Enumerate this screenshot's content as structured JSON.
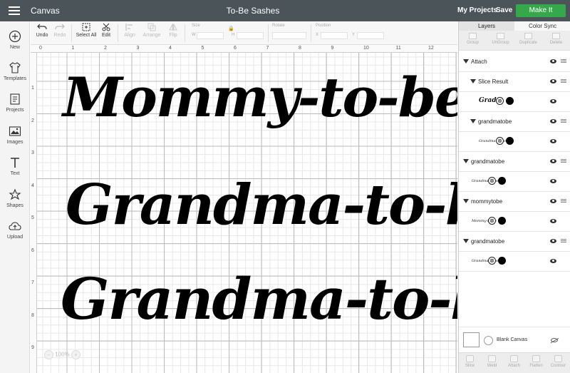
{
  "header": {
    "app_title": "Canvas",
    "doc_title": "To-Be Sashes",
    "my_projects": "My Projects",
    "save": "Save",
    "make_it": "Make It"
  },
  "sidebar": {
    "items": [
      {
        "label": "New",
        "icon": "plus-circle-icon"
      },
      {
        "label": "Templates",
        "icon": "shirt-icon"
      },
      {
        "label": "Projects",
        "icon": "projects-icon"
      },
      {
        "label": "Images",
        "icon": "image-icon"
      },
      {
        "label": "Text",
        "icon": "text-icon"
      },
      {
        "label": "Shapes",
        "icon": "shapes-icon"
      },
      {
        "label": "Upload",
        "icon": "upload-icon"
      }
    ]
  },
  "toolbar": {
    "undo": "Undo",
    "redo": "Redo",
    "select_all": "Select All",
    "edit": "Edit",
    "align": "Align",
    "arrange": "Arrange",
    "flip": "Flip",
    "size_label": "Size",
    "w_label": "W",
    "h_label": "H",
    "rotate_label": "Rotate",
    "position_label": "Position",
    "x_label": "X",
    "y_label": "Y"
  },
  "ruler": {
    "top_ticks": [
      "0",
      "1",
      "2",
      "3",
      "4",
      "5",
      "6",
      "7",
      "8",
      "9",
      "10",
      "11",
      "12"
    ],
    "left_ticks": [
      "1",
      "2",
      "3",
      "4",
      "5",
      "6",
      "7",
      "8",
      "9"
    ]
  },
  "canvas": {
    "lines": [
      "Mommy-to-be",
      "Grandma-to-be",
      "Grandma-to-be"
    ],
    "zoom": "100%"
  },
  "panel": {
    "tabs": [
      "Layers",
      "Color Sync"
    ],
    "actions": [
      "Group",
      "UnGroup",
      "Duplicate",
      "Delete"
    ],
    "layers": [
      {
        "type": "group",
        "label": "Attach"
      },
      {
        "type": "group",
        "label": "Slice Result"
      },
      {
        "type": "item",
        "thumb": "Grad"
      },
      {
        "type": "group",
        "label": "grandmatobe"
      },
      {
        "type": "item",
        "thumb": "Grandma-to-be"
      },
      {
        "type": "group",
        "label": "grandmatobe"
      },
      {
        "type": "item",
        "thumb": "Grandma-to-be"
      },
      {
        "type": "group",
        "label": "mommytobe"
      },
      {
        "type": "item",
        "thumb": "Mommy-to-be"
      },
      {
        "type": "group",
        "label": "grandmatobe"
      },
      {
        "type": "item",
        "thumb": "Grandma-to-be"
      }
    ],
    "blank_canvas": "Blank Canvas",
    "bottom_actions": [
      "Slice",
      "Weld",
      "Attach",
      "Flatten",
      "Contour"
    ]
  },
  "colors": {
    "header_bg": "#4a5459",
    "make_it": "#35a84c"
  }
}
